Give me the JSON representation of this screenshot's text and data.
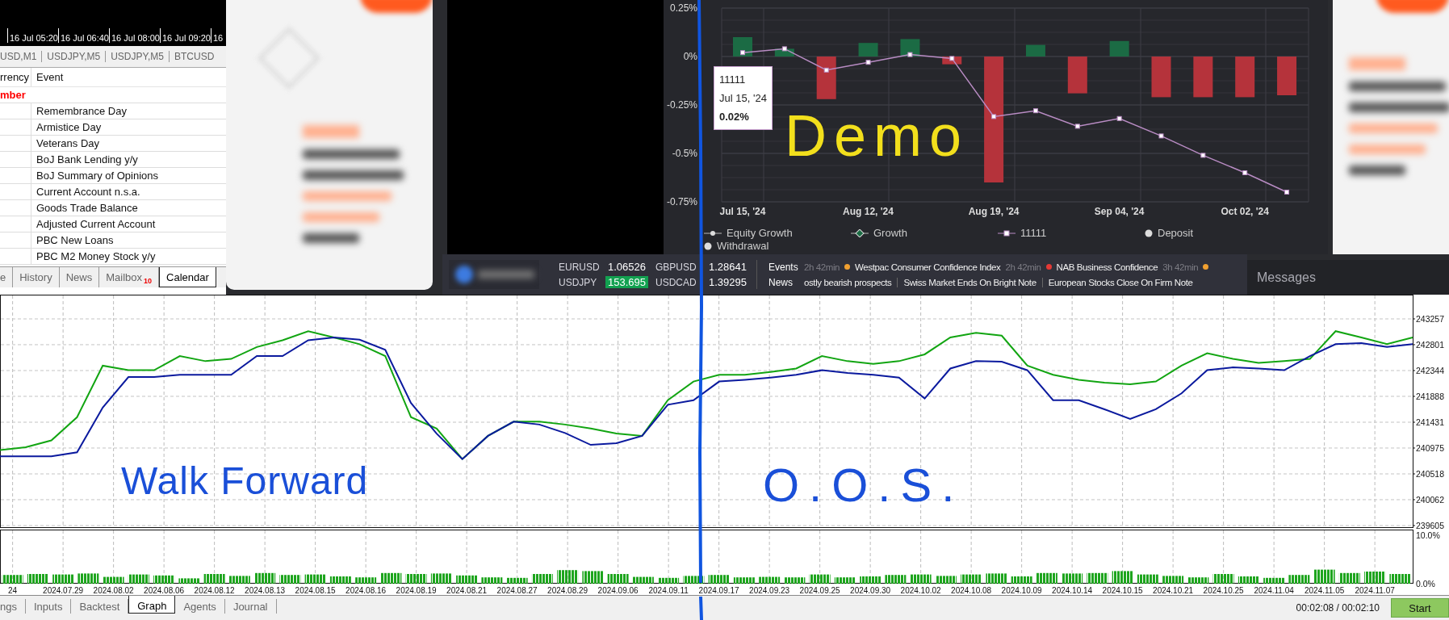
{
  "terminal": {
    "time_axis": [
      "16 Jul 05:20",
      "16 Jul 06:40",
      "16 Jul 08:00",
      "16 Jul 09:20",
      "16"
    ],
    "chart_tabs": [
      {
        "label": "USD,M1",
        "selected": false
      },
      {
        "label": "USDJPY,M5",
        "selected": false
      },
      {
        "label": "USDJPY,M5",
        "selected": false
      },
      {
        "label": "BTCUSD",
        "selected": false
      }
    ],
    "calendar": {
      "columns": [
        "rrency",
        "Event"
      ],
      "group": "mber",
      "rows": [
        {
          "event": "Remembrance Day"
        },
        {
          "event": "Armistice Day"
        },
        {
          "event": "Veterans Day"
        },
        {
          "event": "BoJ Bank Lending y/y"
        },
        {
          "event": "BoJ Summary of Opinions"
        },
        {
          "event": "Current Account n.s.a."
        },
        {
          "event": "Goods Trade Balance"
        },
        {
          "event": "Adjusted Current Account"
        },
        {
          "event": "PBC New Loans"
        },
        {
          "event": "PBC M2 Money Stock y/y"
        }
      ]
    },
    "bottom_tabs": [
      {
        "label": "e",
        "selected": false
      },
      {
        "label": "History",
        "selected": false
      },
      {
        "label": "News",
        "selected": false
      },
      {
        "label": "Mailbox",
        "badge": "10",
        "selected": false
      },
      {
        "label": "Calendar",
        "selected": true
      }
    ]
  },
  "dashboard": {
    "chart": {
      "chart_data": {
        "type": "bar",
        "grid": true,
        "categories": [
          "Jul 15, '24",
          null,
          null,
          "Aug 12, '24",
          null,
          null,
          "Aug 19, '24",
          null,
          null,
          "Sep 04, '24",
          null,
          null,
          "Oct 02, '24",
          null
        ],
        "series": [
          {
            "name": "Growth",
            "color": "#1b6b44",
            "values": [
              0.1,
              0.04,
              null,
              0.07,
              0.09,
              null,
              null,
              0.06,
              null,
              0.08,
              null,
              null,
              null,
              null
            ]
          },
          {
            "color": "#b5333b",
            "values": [
              null,
              null,
              -0.22,
              null,
              null,
              -0.04,
              -0.65,
              null,
              -0.19,
              null,
              -0.21,
              -0.21,
              -0.21,
              -0.2
            ]
          },
          {
            "name": "11111",
            "type": "line",
            "marker": "square",
            "color": "#b98cc4",
            "values": [
              0.02,
              0.04,
              -0.07,
              -0.03,
              0.01,
              -0.01,
              -0.31,
              -0.28,
              -0.36,
              -0.32,
              -0.41,
              -0.51,
              -0.6,
              -0.7
            ]
          }
        ],
        "stacked": true,
        "legend": "bottom",
        "ylim": [
          -0.75,
          0.25
        ],
        "yticks": [
          {
            "value": 0.25,
            "label": "0.25%"
          },
          {
            "value": 0,
            "label": "0%"
          },
          {
            "value": -0.25,
            "label": "-0.25%"
          },
          {
            "value": -0.5,
            "label": "-0.5%"
          },
          {
            "value": -0.75,
            "label": "-0.75%"
          }
        ]
      },
      "tooltip": {
        "series": "11111",
        "date": "Jul 15, '24",
        "value": "0.02%"
      }
    },
    "legend": [
      {
        "label": "Equity Growth",
        "kind": "line-dot"
      },
      {
        "label": "Deposit",
        "kind": "dot"
      },
      {
        "label": "Withdrawal",
        "kind": "dot"
      }
    ]
  },
  "ticker": {
    "quotes": [
      {
        "symbol": "EURUSD",
        "price": "1.06526",
        "highlighted": false
      },
      {
        "symbol": "GBPUSD",
        "price": "1.28641",
        "highlighted": false
      },
      {
        "symbol": "USDJPY",
        "price": "153.695",
        "highlighted": true
      },
      {
        "symbol": "USDCAD",
        "price": "1.39295",
        "highlighted": false
      }
    ],
    "events_label": "Events",
    "events": [
      {
        "kind": "time",
        "text": "2h 42min"
      },
      {
        "kind": "event",
        "title": "Westpac Consumer Confidence Index",
        "color": "#f0a030"
      },
      {
        "kind": "time",
        "text": "2h 42min"
      },
      {
        "kind": "event",
        "title": "NAB Business Confidence",
        "color": "#e53935"
      },
      {
        "kind": "time",
        "text": "3h 42min"
      },
      {
        "kind": "event",
        "color": "#f0a030"
      }
    ],
    "news_label": "News",
    "news": [
      "ostly bearish prospects",
      "Swiss Market Ends On Bright Note",
      "European Stocks Close On Firm Note"
    ]
  },
  "messages": {
    "title": "Messages"
  },
  "tester": {
    "equity": {
      "chart_data": {
        "type": "line",
        "grid": true,
        "series": [
          {
            "color": "#12a512",
            "values": [
              240940,
              240990,
              241110,
              241520,
              242430,
              242350,
              242350,
              242600,
              242510,
              242550,
              242760,
              242880,
              243040,
              242930,
              242810,
              242600,
              241520,
              241320,
              240780,
              241190,
              241440,
              241440,
              241390,
              241320,
              241230,
              241190,
              241820,
              242150,
              242270,
              242270,
              242320,
              242380,
              242600,
              242510,
              242460,
              242510,
              242630,
              242930,
              243010,
              242960,
              242430,
              242270,
              242180,
              242130,
              242100,
              242150,
              242430,
              242650,
              242550,
              242480,
              242510,
              242550,
              243040,
              242930,
              242810,
              242930
            ]
          },
          {
            "color": "#0b1a9e",
            "values": [
              240830,
              240830,
              240830,
              240900,
              241690,
              242230,
              242230,
              242270,
              242270,
              242270,
              242600,
              242600,
              242880,
              242930,
              242890,
              242710,
              241770,
              241230,
              240780,
              241190,
              241440,
              241390,
              241240,
              241030,
              241060,
              241190,
              241740,
              241820,
              242150,
              242180,
              242220,
              242270,
              242350,
              242300,
              242270,
              242220,
              241850,
              242380,
              242510,
              242500,
              242350,
              241820,
              241820,
              241660,
              241490,
              241660,
              241940,
              242350,
              242400,
              242380,
              242350,
              242600,
              242810,
              242830,
              242760,
              242810
            ]
          }
        ],
        "ylim": [
          239605,
          243257
        ],
        "yticks": [
          243257,
          242801,
          242344,
          241888,
          241431,
          240975,
          240518,
          240062,
          239605
        ]
      }
    },
    "volume": {
      "chart_data": {
        "type": "bar",
        "grid": true,
        "categories": [
          "24",
          null,
          "2024.07.29",
          null,
          "2024.08.02",
          null,
          "2024.08.06",
          null,
          "2024.08.12",
          null,
          "2024.08.13",
          null,
          "2024.08.15",
          null,
          "2024.08.16",
          null,
          "2024.08.19",
          null,
          "2024.08.21",
          null,
          "2024.08.27",
          null,
          "2024.08.29",
          null,
          "2024.09.06",
          null,
          "2024.09.11",
          null,
          "2024.09.17",
          null,
          "2024.09.23",
          null,
          "2024.09.25",
          null,
          "2024.09.30",
          null,
          "2024.10.02",
          null,
          "2024.10.08",
          null,
          "2024.10.09",
          null,
          "2024.10.14",
          null,
          "2024.10.15",
          null,
          "2024.10.21",
          null,
          "2024.10.25",
          null,
          "2024.11.04",
          null,
          "2024.11.05",
          null,
          "2024.11.07",
          null
        ],
        "series": [
          {
            "color": "#1ea51e",
            "values": [
              1.8,
              2.0,
              1.9,
              2.1,
              1.4,
              1.9,
              1.7,
              1.1,
              2.0,
              1.6,
              2.2,
              1.8,
              1.9,
              1.5,
              1.3,
              2.2,
              2.0,
              2.1,
              1.7,
              1.3,
              1.2,
              2.0,
              2.8,
              2.6,
              2.0,
              1.4,
              1.2,
              1.6,
              1.8,
              1.3,
              1.4,
              1.3,
              1.9,
              1.3,
              1.5,
              1.8,
              1.9,
              1.6,
              1.9,
              2.1,
              1.5,
              2.2,
              2.1,
              2.2,
              2.6,
              1.9,
              1.6,
              1.3,
              2.0,
              1.5,
              1.2,
              1.8,
              2.9,
              2.2,
              2.5,
              2.0
            ]
          }
        ],
        "ylim": [
          0,
          11
        ],
        "yticks": [
          {
            "value": 10,
            "label": "10.0%"
          },
          {
            "value": 0,
            "label": "0.0%"
          }
        ]
      }
    },
    "tabs": [
      {
        "label": "ngs",
        "selected": false
      },
      {
        "label": "Inputs",
        "selected": false
      },
      {
        "label": "Backtest",
        "selected": false
      },
      {
        "label": "Graph",
        "selected": true
      },
      {
        "label": "Agents",
        "selected": false
      },
      {
        "label": "Journal",
        "selected": false
      }
    ],
    "elapsed": "00:02:08 / 00:02:10",
    "start_button": "Start"
  },
  "annotations": [
    {
      "text": "Demo",
      "color": "#f2df1c"
    },
    {
      "text": "Walk Forward",
      "color": "#1a4fd8"
    },
    {
      "text": "O.O.S.",
      "color": "#1a4fd8"
    }
  ]
}
